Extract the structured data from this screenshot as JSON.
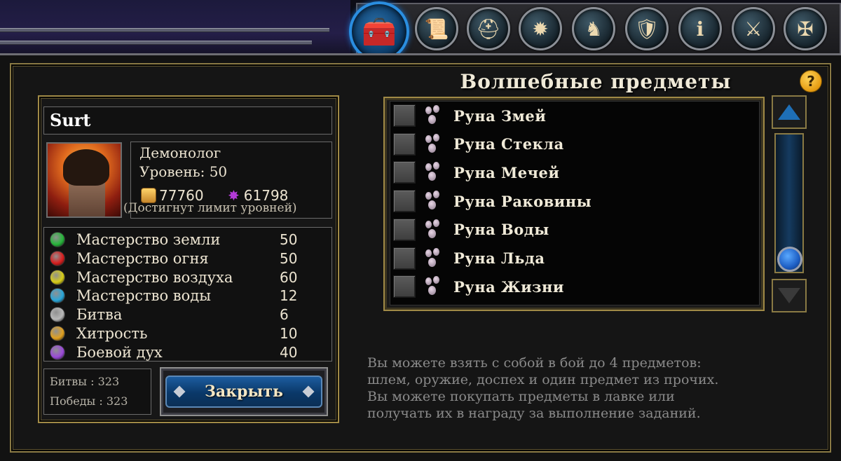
{
  "tabs": [
    {
      "name": "inventory-tab",
      "icon": "treasure-chest-icon",
      "glyph": "🧰",
      "active": true
    },
    {
      "name": "scroll-tab",
      "icon": "scroll-icon",
      "glyph": "📜"
    },
    {
      "name": "armor-tab",
      "icon": "knight-helmet-icon",
      "glyph": "⛑"
    },
    {
      "name": "magic-tab",
      "icon": "sun-burst-icon",
      "glyph": "✹"
    },
    {
      "name": "cavalry-tab",
      "icon": "horse-rider-icon",
      "glyph": "♞"
    },
    {
      "name": "banner-tab",
      "icon": "dragon-banner-icon",
      "glyph": "🛡"
    },
    {
      "name": "info-tab",
      "icon": "info-figure-icon",
      "glyph": "ℹ"
    },
    {
      "name": "weapon-tab",
      "icon": "flail-icon",
      "glyph": "⚔"
    },
    {
      "name": "emblem-tab",
      "icon": "iron-cross-icon",
      "glyph": "✠"
    }
  ],
  "character": {
    "name": "Surt",
    "class": "Демонолог",
    "level_label": "Уровень: 50",
    "gold": "77760",
    "mana": "61798",
    "limit_note": "(Достигнут лимит уровней)"
  },
  "skills": [
    {
      "label": "Мастерство земли",
      "value": "50",
      "color": "#27b43a"
    },
    {
      "label": "Мастерство огня",
      "value": "50",
      "color": "#d81e1e"
    },
    {
      "label": "Мастерство воздуха",
      "value": "60",
      "color": "#d6cc18"
    },
    {
      "label": "Мастерство воды",
      "value": "12",
      "color": "#2aa6d8"
    },
    {
      "label": "Битва",
      "value": "6",
      "color": "#b8b8b8"
    },
    {
      "label": "Хитрость",
      "value": "10",
      "color": "#e0a020"
    },
    {
      "label": "Боевой дух",
      "value": "40",
      "color": "#9a4ad8"
    }
  ],
  "stats": {
    "battles": "Битвы  : 323",
    "wins": "Победы  : 323"
  },
  "close_button": "Закрыть",
  "section_title": "Волшебные предметы",
  "help_label": "?",
  "items": [
    {
      "label": "Руна Змей"
    },
    {
      "label": "Руна Стекла"
    },
    {
      "label": "Руна Мечей"
    },
    {
      "label": "Руна Раковины"
    },
    {
      "label": "Руна Воды"
    },
    {
      "label": "Руна Льда"
    },
    {
      "label": "Руна Жизни"
    }
  ],
  "note_lines": [
    "Вы можете взять с собой в бой до 4 предметов:",
    "шлем, оружие, доспех и один предмет из прочих.",
    "Вы можете покупать предметы в лавке или",
    "получать их в награду за выполнение заданий."
  ]
}
